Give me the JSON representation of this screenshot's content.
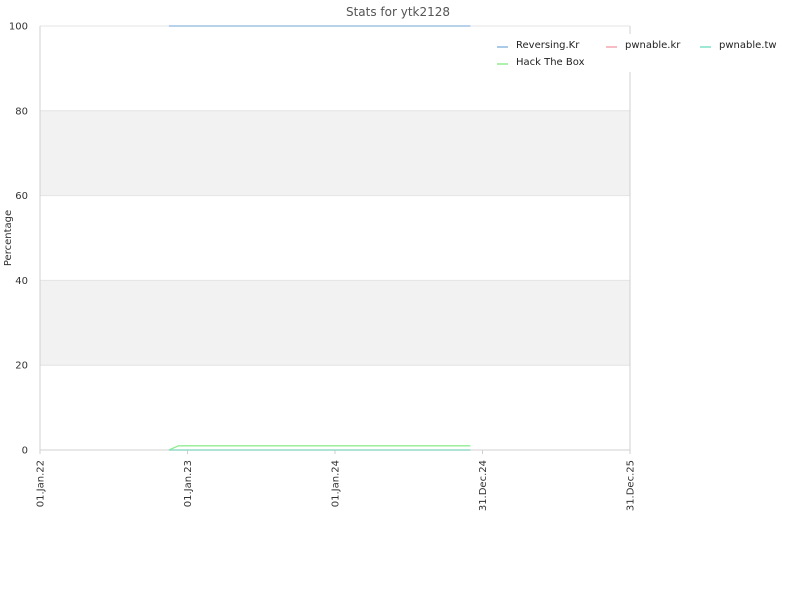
{
  "chart_data": {
    "type": "line",
    "title": "Stats for ytk2128",
    "xlabel": "",
    "ylabel": "Percentage",
    "ylim": [
      0,
      100
    ],
    "yticks": [
      0,
      20,
      40,
      60,
      80,
      100
    ],
    "xlim": [
      "2022-01-01",
      "2025-12-31"
    ],
    "xticks": [
      {
        "date": "2022-01-01",
        "label": "01.Jan.22"
      },
      {
        "date": "2023-01-01",
        "label": "01.Jan.23"
      },
      {
        "date": "2024-01-01",
        "label": "01.Jan.24"
      },
      {
        "date": "2024-12-31",
        "label": "31.Dec.24"
      },
      {
        "date": "2025-12-31",
        "label": "31.Dec.25"
      }
    ],
    "grid": "horizontal bands",
    "legend_position": "top-right",
    "series": [
      {
        "name": "Reversing.Kr",
        "color": "#8fb8e0",
        "points": [
          [
            "2022-11-16",
            100
          ],
          [
            "2024-12-01",
            100
          ]
        ]
      },
      {
        "name": "Hack The Box",
        "color": "#90ee90",
        "points": [
          [
            "2022-11-16",
            0
          ],
          [
            "2022-12-10",
            1
          ],
          [
            "2024-12-01",
            1
          ]
        ]
      },
      {
        "name": "pwnable.kr",
        "color": "#f4a6b0",
        "points": [
          [
            "2022-11-16",
            0
          ],
          [
            "2024-12-01",
            0
          ]
        ]
      },
      {
        "name": "pwnable.tw",
        "color": "#7fe0c8",
        "points": [
          [
            "2022-11-16",
            0
          ],
          [
            "2024-12-01",
            0
          ]
        ]
      }
    ],
    "legend_order": [
      "Reversing.Kr",
      "pwnable.kr",
      "pwnable.tw",
      "Hack The Box"
    ]
  }
}
